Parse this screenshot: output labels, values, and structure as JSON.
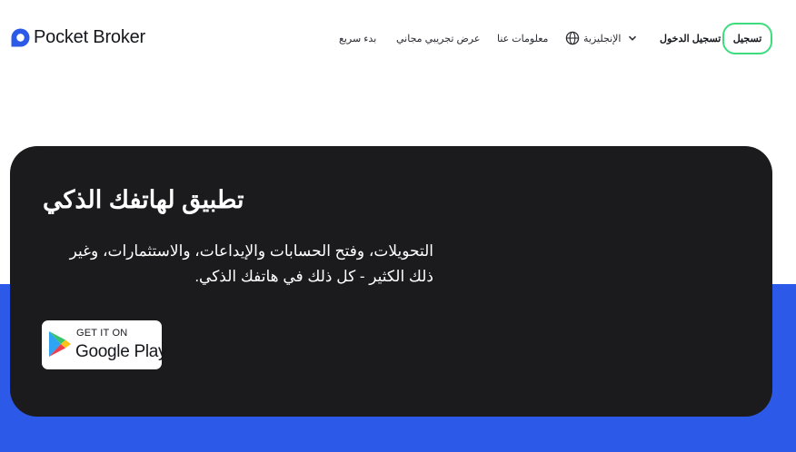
{
  "brand": {
    "name": "Pocket Broker",
    "accent": "#2c59e7"
  },
  "nav": {
    "quick_start": "بدء سريع",
    "free_demo": "عرض تجريبي مجاني",
    "about": "معلومات عنا",
    "language": "الإنجليزية",
    "login": "تسجيل الدخول",
    "signup": "تسجيل"
  },
  "hero": {
    "title": "تطبيق لهاتفك الذكي",
    "description": "التحويلات، وفتح الحسابات والإيداعات، والاستثمارات، وغير ذلك الكثير - كل ذلك في هاتفك الذكي.",
    "store_badge": {
      "small": "GET IT ON",
      "big": "Google Play"
    }
  },
  "colors": {
    "card_bg": "#1b1a1d",
    "band_blue": "#2c59e7",
    "signup_border": "#3fdc7f"
  },
  "icons": [
    "pocket-broker-logo-icon",
    "globe-icon",
    "chevron-down-icon",
    "google-play-icon"
  ]
}
